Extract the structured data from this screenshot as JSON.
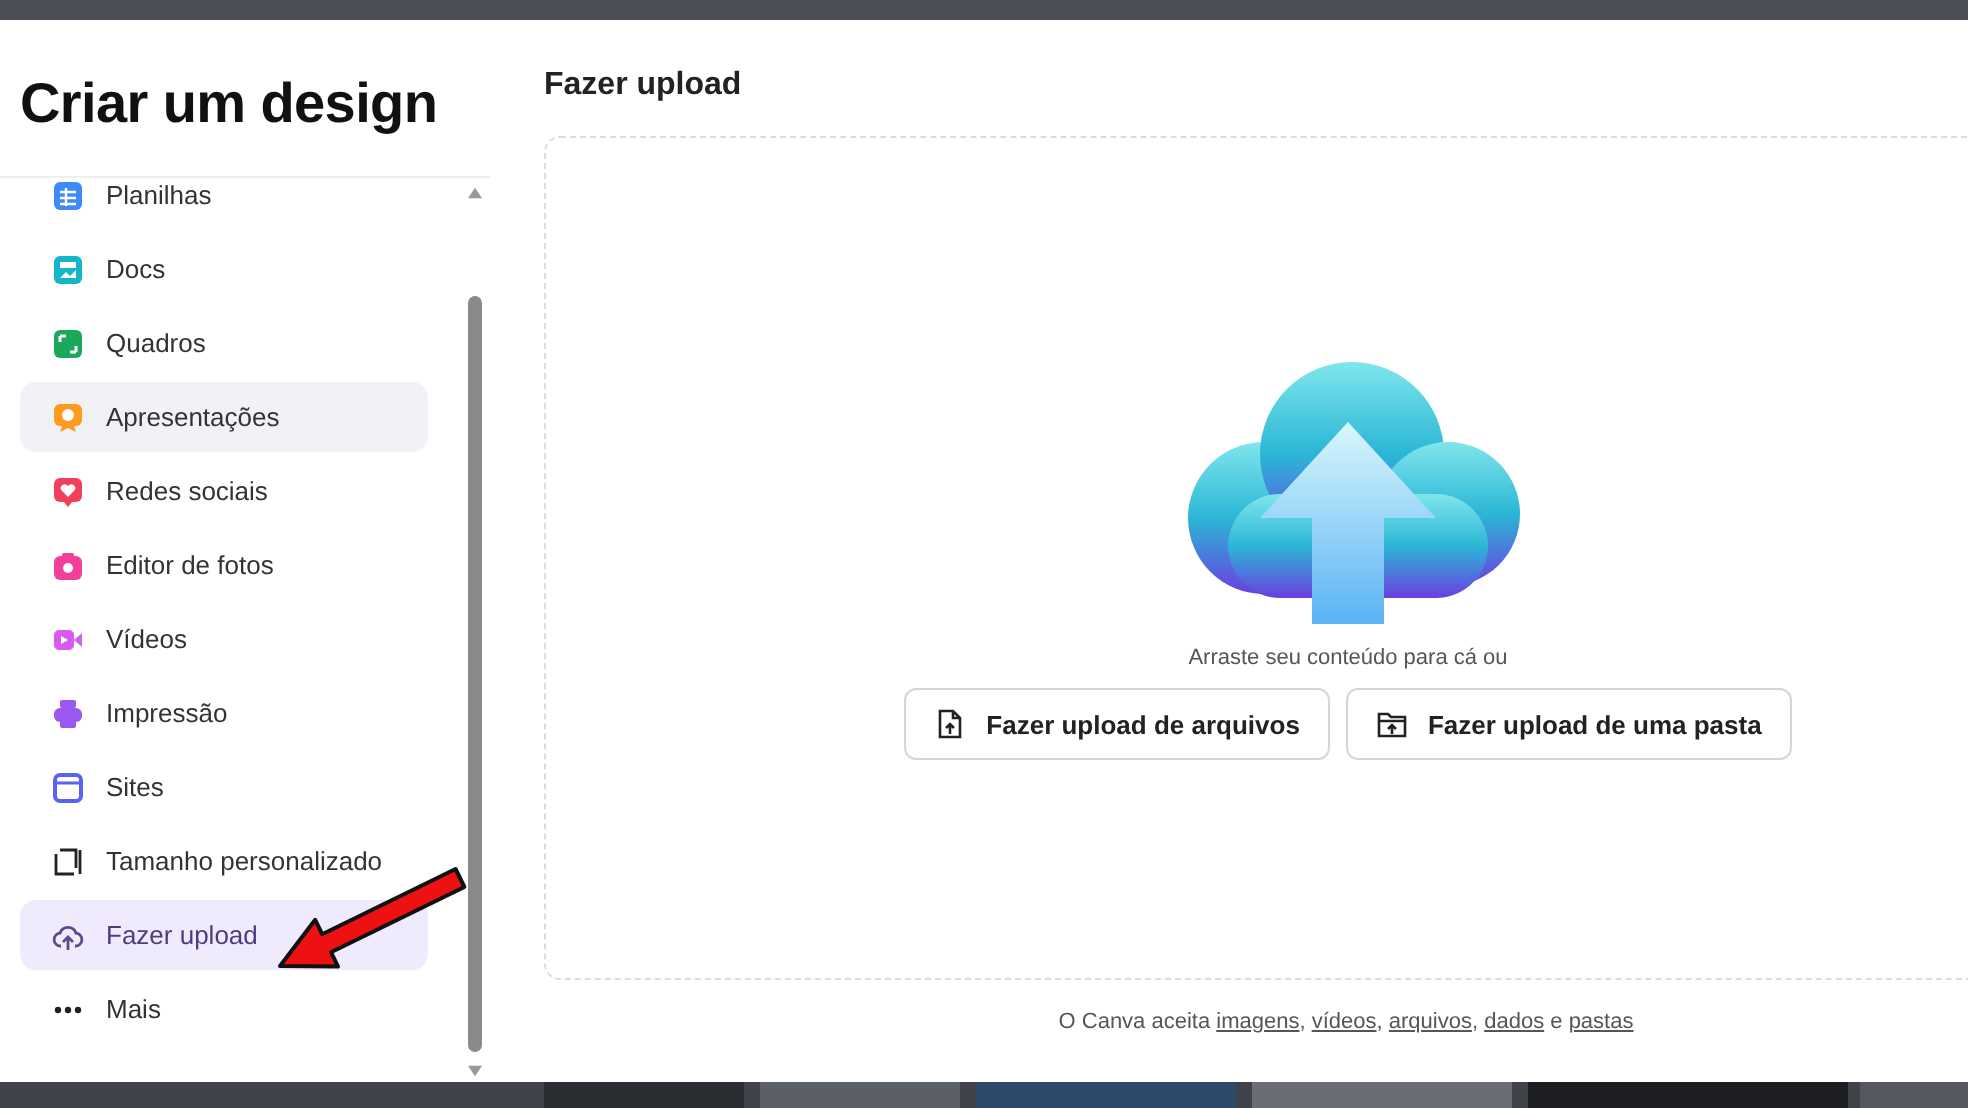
{
  "dialog": {
    "title": "Criar um design"
  },
  "sidebar": {
    "items": [
      {
        "label": "Planilhas",
        "kind": "grid",
        "color": "#3d8af7",
        "selected": false,
        "hovered": false
      },
      {
        "label": "Docs",
        "kind": "doc",
        "color": "#13b5c8",
        "selected": false,
        "hovered": false
      },
      {
        "label": "Quadros",
        "kind": "board",
        "color": "#1ca85a",
        "selected": false,
        "hovered": false
      },
      {
        "label": "Apresentações",
        "kind": "presentation",
        "color": "#ff9a1f",
        "selected": false,
        "hovered": true
      },
      {
        "label": "Redes sociais",
        "kind": "heart",
        "color": "#f0415a",
        "selected": false,
        "hovered": false
      },
      {
        "label": "Editor de fotos",
        "kind": "camera",
        "color": "#f2409a",
        "selected": false,
        "hovered": false
      },
      {
        "label": "Vídeos",
        "kind": "video",
        "color": "#d65cf0",
        "selected": false,
        "hovered": false
      },
      {
        "label": "Impressão",
        "kind": "print",
        "color": "#9b59f2",
        "selected": false,
        "hovered": false
      },
      {
        "label": "Sites",
        "kind": "site",
        "color": "#5a63f0",
        "selected": false,
        "hovered": false
      },
      {
        "label": "Tamanho personalizado",
        "kind": "resize",
        "color": "#222222",
        "selected": false,
        "hovered": false
      },
      {
        "label": "Fazer upload",
        "kind": "cloud",
        "color": "#5b4a8c",
        "selected": true,
        "hovered": false
      },
      {
        "label": "Mais",
        "kind": "dots",
        "color": "#222222",
        "selected": false,
        "hovered": false
      }
    ]
  },
  "upload": {
    "title": "Fazer upload",
    "hint": "Arraste seu conteúdo para cá ou",
    "buttons": [
      {
        "label": "Fazer upload de arquivos",
        "kind": "file"
      },
      {
        "label": "Fazer upload de uma pasta",
        "kind": "folder"
      }
    ],
    "footer": [
      {
        "kind": "text",
        "text": "O Canva aceita "
      },
      {
        "kind": "link",
        "text": "imagens"
      },
      {
        "kind": "text",
        "text": ", "
      },
      {
        "kind": "link",
        "text": "vídeos"
      },
      {
        "kind": "text",
        "text": ", "
      },
      {
        "kind": "link",
        "text": "arquivos"
      },
      {
        "kind": "text",
        "text": ", "
      },
      {
        "kind": "link",
        "text": "dados"
      },
      {
        "kind": "text",
        "text": " e "
      },
      {
        "kind": "link",
        "text": "pastas"
      }
    ]
  }
}
